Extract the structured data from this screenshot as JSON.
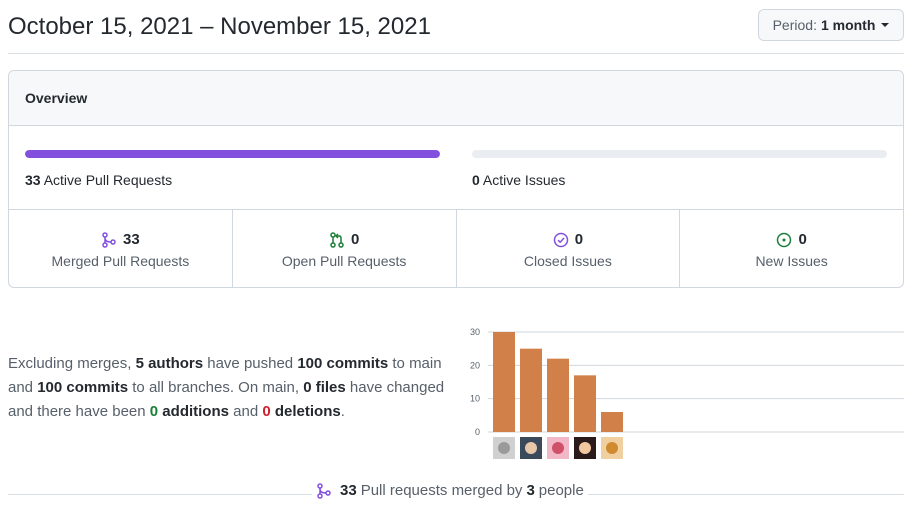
{
  "header": {
    "date_range": "October 15, 2021 – November 15, 2021",
    "period_label": "Period:",
    "period_value": "1 month"
  },
  "overview": {
    "title": "Overview",
    "pull_requests_bar": {
      "count": "33",
      "label": "Active Pull Requests",
      "fill_fraction": 1.0
    },
    "issues_bar": {
      "count": "0",
      "label": "Active Issues",
      "fill_fraction": 0
    },
    "stats": [
      {
        "count": "33",
        "label": "Merged Pull Requests",
        "icon": "git-merge-icon",
        "color": "#8250df"
      },
      {
        "count": "0",
        "label": "Open Pull Requests",
        "icon": "git-pull-request-icon",
        "color": "#1a7f37"
      },
      {
        "count": "0",
        "label": "Closed Issues",
        "icon": "issue-closed-icon",
        "color": "#8250df"
      },
      {
        "count": "0",
        "label": "New Issues",
        "icon": "issue-opened-icon",
        "color": "#1a7f37"
      }
    ]
  },
  "summary": {
    "t1": "Excluding merges, ",
    "authors": "5 authors",
    "t2": " have pushed ",
    "commits_main": "100 commits",
    "t3": " to main and ",
    "commits_all": "100 commits",
    "t4": " to all branches. On main, ",
    "files": "0 files",
    "t5": " have changed and there have been ",
    "additions_count": "0",
    "additions_word": " additions",
    "t6": " and ",
    "deletions_count": "0",
    "deletions_word": " deletions",
    "t7": "."
  },
  "chart_data": {
    "type": "bar",
    "categories": [
      "author-1",
      "author-2",
      "author-3",
      "author-4",
      "author-5"
    ],
    "values": [
      30,
      25,
      22,
      17,
      6
    ],
    "ylim": [
      0,
      30
    ],
    "yticks": [
      "0",
      "10",
      "20",
      "30"
    ],
    "grid": true,
    "bar_color": "#d1804a",
    "avatars": [
      "avatar-light-gray",
      "avatar-dark-person",
      "avatar-pink-pattern",
      "avatar-person-dark-hair",
      "avatar-orange-pattern"
    ]
  },
  "footer": {
    "count": "33",
    "text1": "Pull requests merged by",
    "people": "3",
    "text2": "people"
  }
}
